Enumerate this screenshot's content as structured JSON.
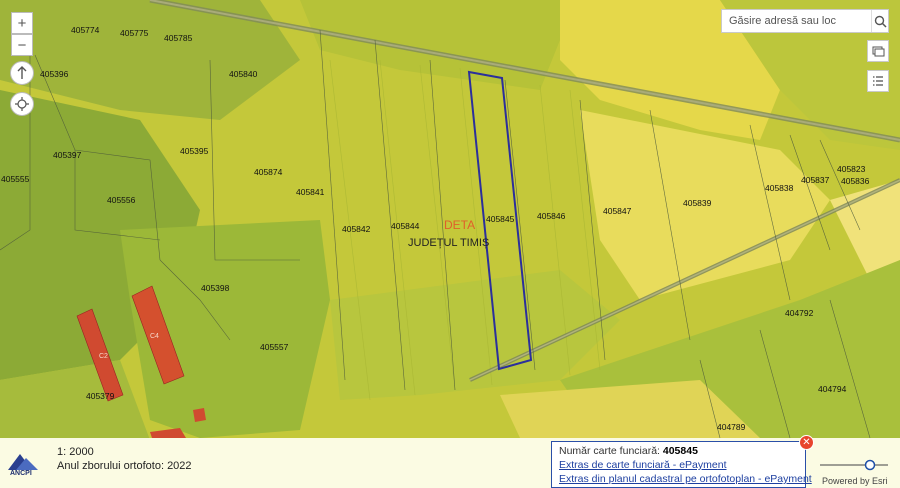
{
  "map": {
    "parcels": [
      {
        "id": "405774",
        "label": "405774"
      },
      {
        "id": "405775",
        "label": "405775"
      },
      {
        "id": "405785",
        "label": "405785"
      },
      {
        "id": "405396",
        "label": "405396"
      },
      {
        "id": "405840",
        "label": "405840"
      },
      {
        "id": "405397",
        "label": "405397"
      },
      {
        "id": "405395",
        "label": "405395"
      },
      {
        "id": "405555",
        "label": "405555"
      },
      {
        "id": "405874",
        "label": "405874"
      },
      {
        "id": "405841",
        "label": "405841"
      },
      {
        "id": "405556",
        "label": "405556"
      },
      {
        "id": "405842",
        "label": "405842"
      },
      {
        "id": "405844",
        "label": "405844"
      },
      {
        "id": "405845",
        "label": "405845"
      },
      {
        "id": "405846",
        "label": "405846"
      },
      {
        "id": "405847",
        "label": "405847"
      },
      {
        "id": "405839",
        "label": "405839"
      },
      {
        "id": "405838",
        "label": "405838"
      },
      {
        "id": "405837",
        "label": "405837"
      },
      {
        "id": "405823",
        "label": "405823"
      },
      {
        "id": "405836",
        "label": "405836"
      },
      {
        "id": "405398",
        "label": "405398"
      },
      {
        "id": "405557",
        "label": "405557"
      },
      {
        "id": "405379",
        "label": "405379"
      },
      {
        "id": "404792",
        "label": "404792"
      },
      {
        "id": "404794",
        "label": "404794"
      },
      {
        "id": "404789",
        "label": "404789"
      }
    ],
    "locality": "DETA",
    "county": "JUDEȚUL TIMIȘ",
    "buildings": [
      {
        "label": "C2"
      },
      {
        "label": "C4"
      }
    ]
  },
  "controls": {
    "zoom_in": "+",
    "zoom_out": "−",
    "search_placeholder": "Găsire adresă sau loc"
  },
  "bottom": {
    "scale": "1: 2000",
    "ortho_year": "Anul zborului ortofoto: 2022",
    "logo_text": "ANCPI"
  },
  "popup": {
    "title_label": "Număr carte funciară: ",
    "title_value": "405845",
    "link1": "Extras de carte funciară - ePayment",
    "link2": "Extras din planul cadastral pe ortofotoplan - ePayment"
  },
  "powered_by": "Powered by Esri",
  "colors": {
    "selected_parcel": "#2b2f9c",
    "road": "#8a8a6a"
  }
}
